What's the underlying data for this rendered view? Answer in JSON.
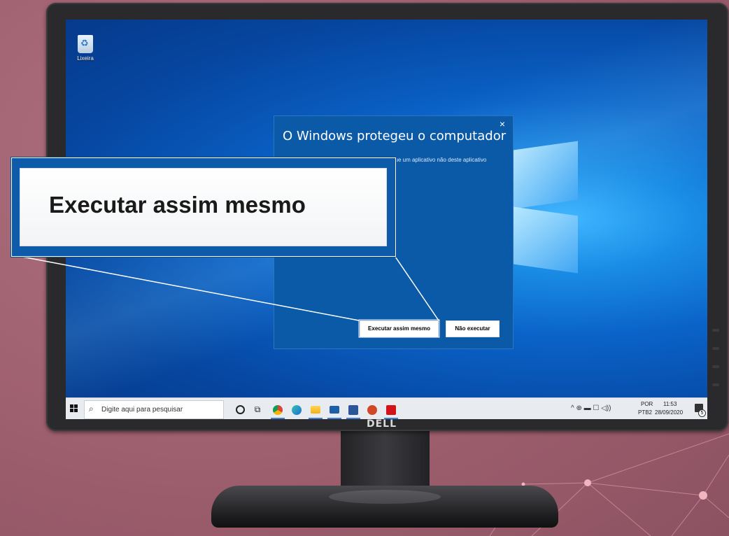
{
  "colors": {
    "background": "#9e5f6e",
    "desktop": "#0a62c7",
    "dialog": "#0b5aa8",
    "taskbar": "#e8ecf1"
  },
  "desktop": {
    "recycle_bin_label": "Lixeira"
  },
  "dialog": {
    "close_glyph": "×",
    "title": "O Windows protegeu o computador",
    "body": "O Microsoft defender SmartScreen impediu que um aplicativo não deste aplicativo pode colocar o",
    "more_info": "o",
    "run_button": "Executar assim mesmo",
    "dont_run_button": "Não executar"
  },
  "callout": {
    "text": "Executar assim mesmo"
  },
  "taskbar": {
    "search_placeholder": "Digite aqui para pesquisar",
    "pinned_icons": [
      "cortana-icon",
      "task-view-icon",
      "chrome-icon",
      "edge-icon",
      "file-explorer-icon",
      "mail-icon",
      "word-icon",
      "powerpoint-icon",
      "acrobat-icon"
    ],
    "tray": {
      "language_top": "POR",
      "language_bottom": "PTB2",
      "time": "11:53",
      "date": "28/09/2020",
      "notifications_count": "5"
    }
  },
  "monitor": {
    "brand": "DELL"
  }
}
